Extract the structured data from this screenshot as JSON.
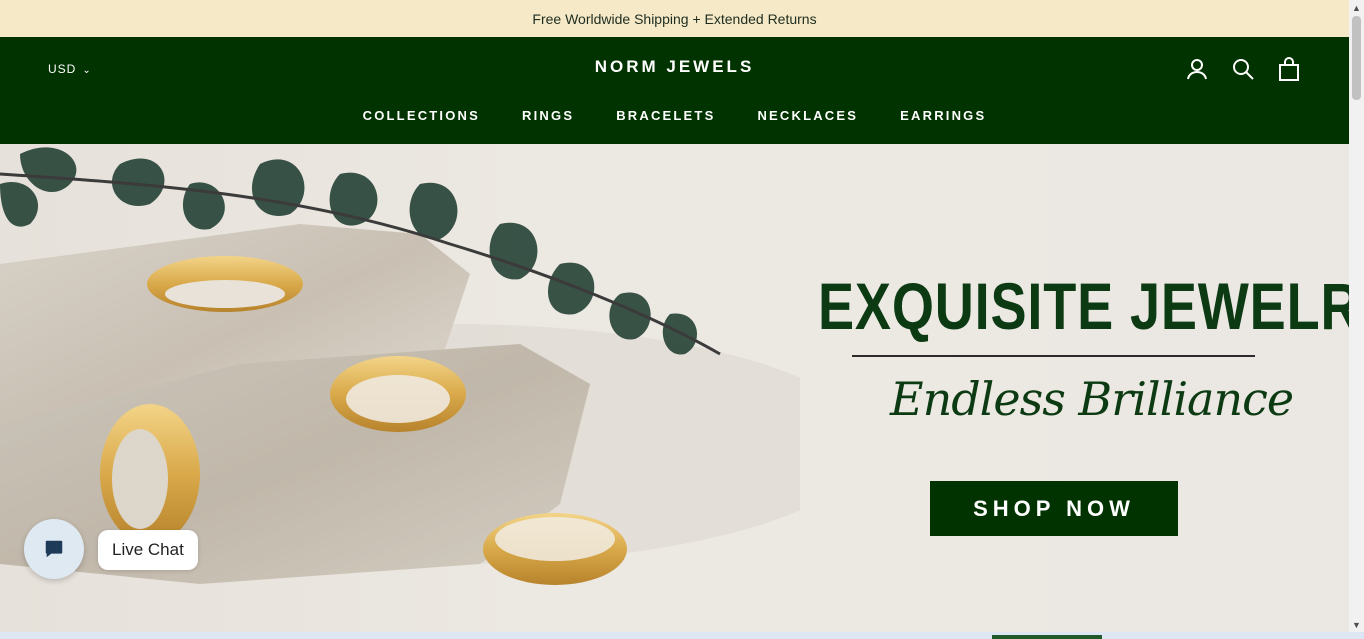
{
  "announcement": "Free Worldwide Shipping + Extended Returns",
  "header": {
    "currency": "USD",
    "brand": "NORM JEWELS",
    "icons": [
      "account-icon",
      "search-icon",
      "cart-icon"
    ]
  },
  "nav": {
    "items": [
      "COLLECTIONS",
      "RINGS",
      "BRACELETS",
      "NECKLACES",
      "EARRINGS"
    ]
  },
  "hero": {
    "title": "EXQUISITE JEWELRY",
    "subtitle": "Endless Brilliance",
    "cta": "SHOP NOW"
  },
  "chat": {
    "label": "Live Chat"
  },
  "colors": {
    "brand_green": "#003300",
    "announcement_bg": "#f5e9c8",
    "hero_text": "#0c3a12"
  }
}
